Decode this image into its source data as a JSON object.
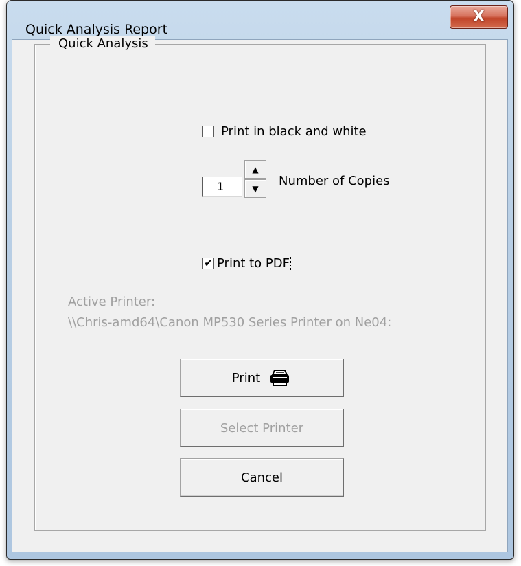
{
  "window": {
    "title": "Quick Analysis Report",
    "close_symbol": "X"
  },
  "group": {
    "label": "Quick Analysis"
  },
  "options": {
    "bw_label": "Print in black and white",
    "bw_checked": false,
    "copies_value": "1",
    "copies_label": "Number of Copies",
    "pdf_label": "Print to PDF",
    "pdf_checked": true
  },
  "printer": {
    "label": "Active Printer:",
    "path": "\\\\Chris-amd64\\Canon MP530 Series Printer on Ne04:"
  },
  "buttons": {
    "print_label": "Print",
    "select_printer_label": "Select Printer",
    "cancel_label": "Cancel"
  },
  "colors": {
    "disabled_text": "#a0a0a0",
    "close_button": "#c1452a",
    "dialog_face": "#f0f0f0"
  },
  "icons": {
    "print": "printer-icon",
    "spin_up": "arrow-up-icon",
    "spin_down": "arrow-down-icon",
    "check": "check-icon"
  }
}
